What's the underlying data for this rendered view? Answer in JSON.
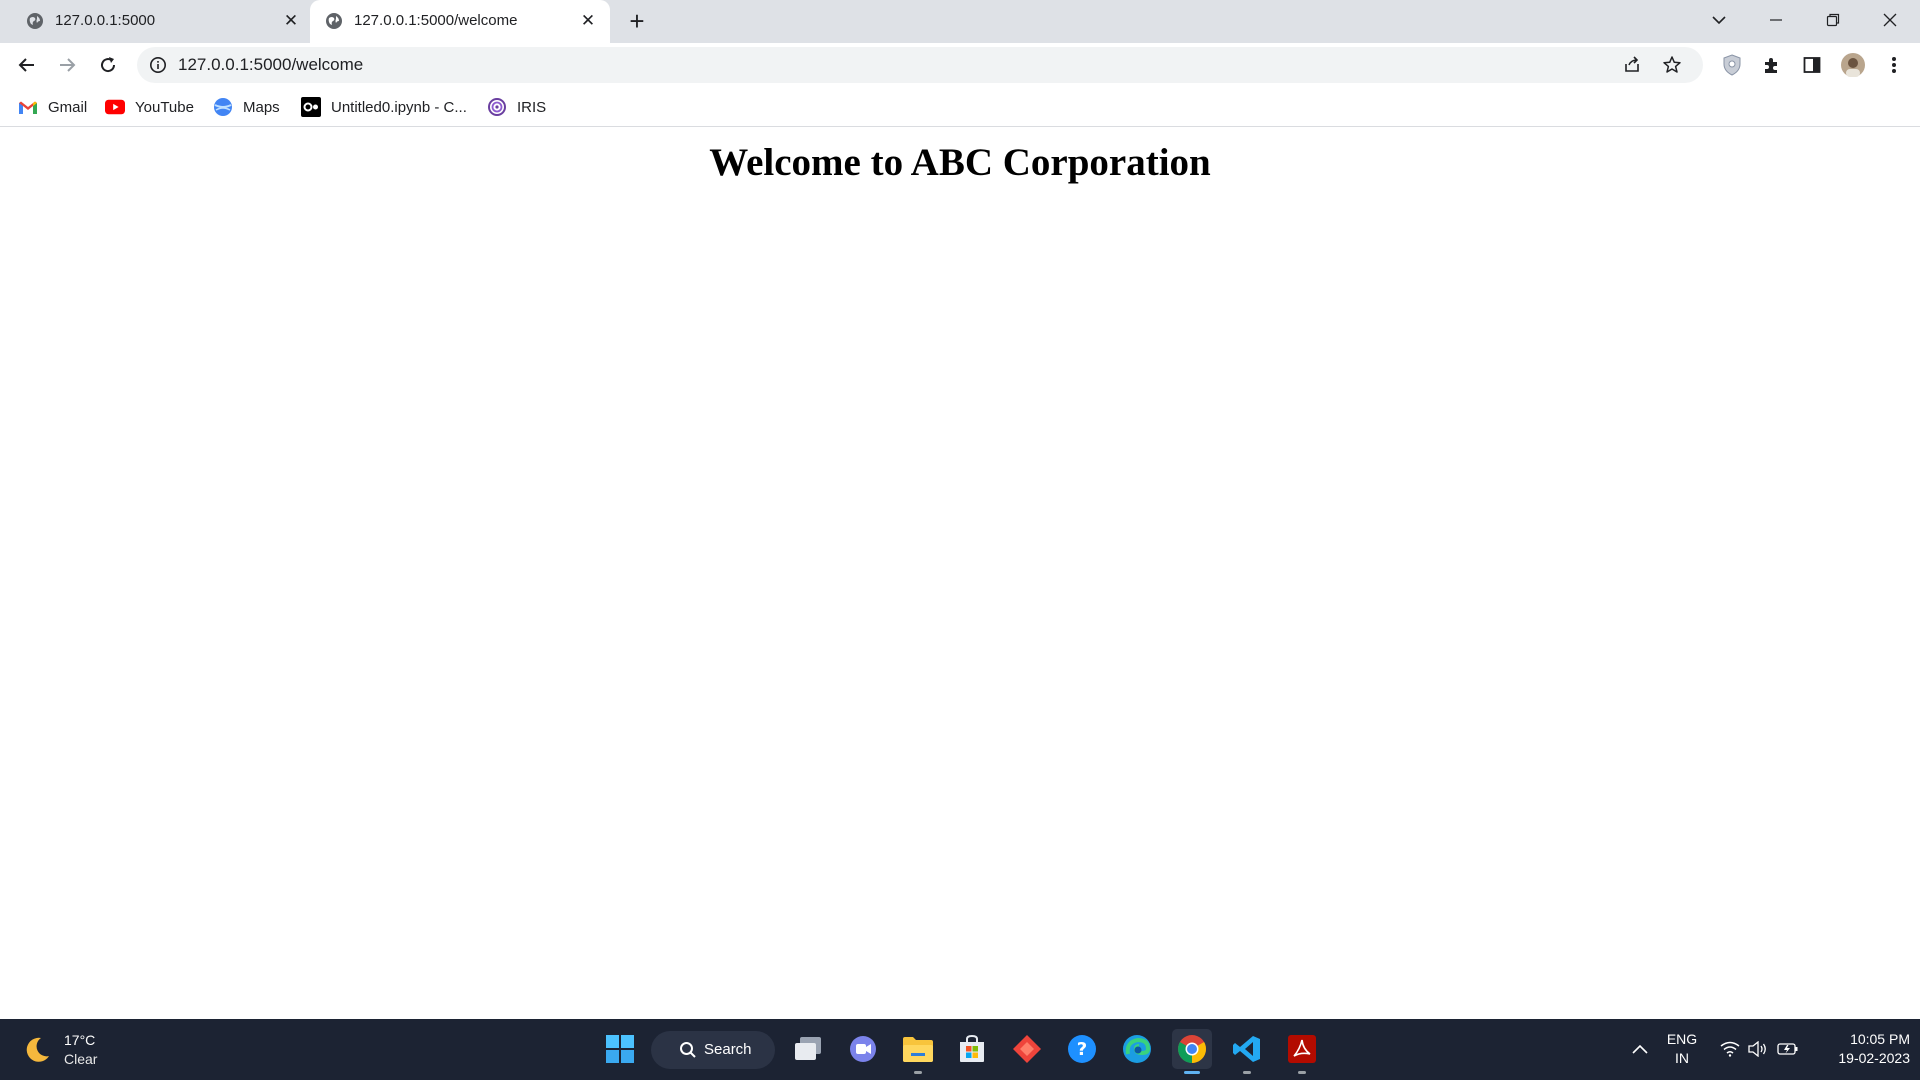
{
  "browser": {
    "tabs": [
      {
        "title": "127.0.0.1:5000",
        "active": false
      },
      {
        "title": "127.0.0.1:5000/welcome",
        "active": true
      }
    ],
    "url": "127.0.0.1:5000/welcome",
    "bookmarks": [
      {
        "label": "Gmail",
        "icon": "gmail-icon"
      },
      {
        "label": "YouTube",
        "icon": "youtube-icon"
      },
      {
        "label": "Maps",
        "icon": "maps-icon"
      },
      {
        "label": "Untitled0.ipynb - C...",
        "icon": "colab-icon"
      },
      {
        "label": "IRIS",
        "icon": "iris-icon"
      }
    ]
  },
  "page": {
    "heading": "Welcome to ABC Corporation"
  },
  "taskbar": {
    "weather": {
      "temp": "17°C",
      "condition": "Clear"
    },
    "search_label": "Search",
    "apps": [
      "start",
      "search",
      "task-view",
      "teams-chat",
      "file-explorer",
      "microsoft-store",
      "anydesk",
      "get-help",
      "edge",
      "chrome",
      "vscode",
      "acrobat"
    ],
    "language": {
      "line1": "ENG",
      "line2": "IN"
    },
    "time": "10:05 PM",
    "date": "19-02-2023"
  },
  "colors": {
    "tabstrip": "#dee1e6",
    "taskbar": "#1c2333",
    "accent": "#5fb2f2"
  }
}
